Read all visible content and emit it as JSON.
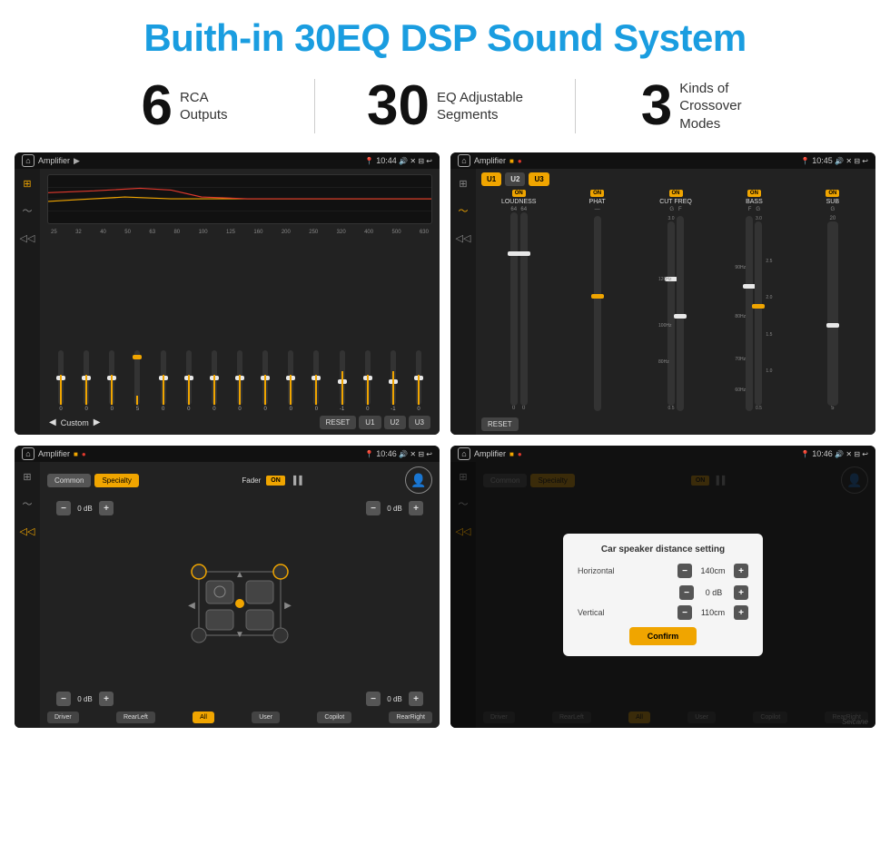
{
  "header": {
    "title": "Buith-in 30EQ DSP Sound System"
  },
  "stats": [
    {
      "number": "6",
      "text": "RCA\nOutputs"
    },
    {
      "number": "30",
      "text": "EQ Adjustable\nSegments"
    },
    {
      "number": "3",
      "text": "Kinds of\nCrossover Modes"
    }
  ],
  "screens": {
    "screen1": {
      "title": "Amplifier",
      "time": "10:44",
      "eq_freqs": [
        "25",
        "32",
        "40",
        "50",
        "63",
        "80",
        "100",
        "125",
        "160",
        "200",
        "250",
        "320",
        "400",
        "500",
        "630"
      ],
      "eq_values": [
        "0",
        "0",
        "0",
        "5",
        "0",
        "0",
        "0",
        "0",
        "0",
        "0",
        "0",
        "-1",
        "0",
        "-1",
        "0"
      ],
      "buttons": {
        "custom": "Custom",
        "reset": "RESET",
        "u1": "U1",
        "u2": "U2",
        "u3": "U3"
      }
    },
    "screen2": {
      "title": "Amplifier",
      "time": "10:45",
      "channels": [
        "U1",
        "U2",
        "U3"
      ],
      "bands": [
        {
          "label": "LOUDNESS",
          "on": true
        },
        {
          "label": "PHAT",
          "on": true
        },
        {
          "label": "CUT FREQ",
          "on": true
        },
        {
          "label": "BASS",
          "on": true
        },
        {
          "label": "SUB",
          "on": true
        }
      ],
      "reset": "RESET"
    },
    "screen3": {
      "title": "Amplifier",
      "time": "10:46",
      "tabs": [
        "Common",
        "Specialty"
      ],
      "fader_label": "Fader",
      "on_label": "ON",
      "db_values": [
        "0 dB",
        "0 dB",
        "0 dB",
        "0 dB"
      ],
      "bottom_btns": [
        "Driver",
        "RearLeft",
        "All",
        "User",
        "Copilot",
        "RearRight"
      ]
    },
    "screen4": {
      "title": "Amplifier",
      "time": "10:46",
      "tabs": [
        "Common",
        "Specialty"
      ],
      "on_label": "ON",
      "dialog": {
        "title": "Car speaker distance setting",
        "horizontal_label": "Horizontal",
        "horizontal_value": "140cm",
        "vertical_label": "Vertical",
        "vertical_value": "110cm",
        "confirm_label": "Confirm"
      },
      "db_values": [
        "0 dB"
      ],
      "bottom_btns": [
        "Driver",
        "RearLeft",
        "All",
        "User",
        "Copilot",
        "RearRight"
      ],
      "watermark": "Seicane"
    }
  }
}
